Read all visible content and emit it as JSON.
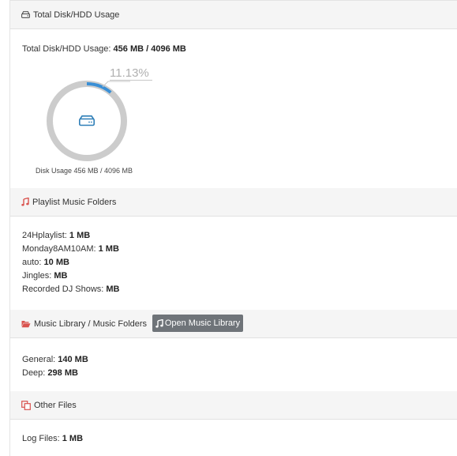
{
  "disk_panel": {
    "icon": "hdd-icon",
    "title": "Total Disk/HDD Usage",
    "usage_label": "Total Disk/HDD Usage: ",
    "usage_value": "456 MB / 4096 MB",
    "percent_text": "11.13%",
    "percent_fraction": 0.1113,
    "gauge_caption": "Disk Usage 456 MB / 4096 MB",
    "accent_color": "#3a8fd6",
    "track_color": "#cccccc"
  },
  "playlist_panel": {
    "icon": "music-note-icon",
    "icon_color": "#d9534f",
    "title": "Playlist Music Folders",
    "items": [
      {
        "label": "24Hplaylist: ",
        "value": "1 MB"
      },
      {
        "label": "Monday8AM10AM: ",
        "value": "1 MB"
      },
      {
        "label": "auto: ",
        "value": "10 MB"
      },
      {
        "label": "Jingles: ",
        "value": "MB"
      },
      {
        "label": "Recorded DJ Shows: ",
        "value": "MB"
      }
    ]
  },
  "library_panel": {
    "icon": "folder-open-icon",
    "icon_color": "#d9534f",
    "title": "Music Library / Music Folders",
    "button_icon": "music-note-icon",
    "button_label": "Open Music Library",
    "items": [
      {
        "label": "General: ",
        "value": "140 MB"
      },
      {
        "label": "Deep: ",
        "value": "298 MB"
      }
    ]
  },
  "other_panel": {
    "icon": "copy-files-icon",
    "icon_color": "#d9534f",
    "title": "Other Files",
    "items": [
      {
        "label": "Log Files: ",
        "value": "1 MB"
      }
    ]
  }
}
